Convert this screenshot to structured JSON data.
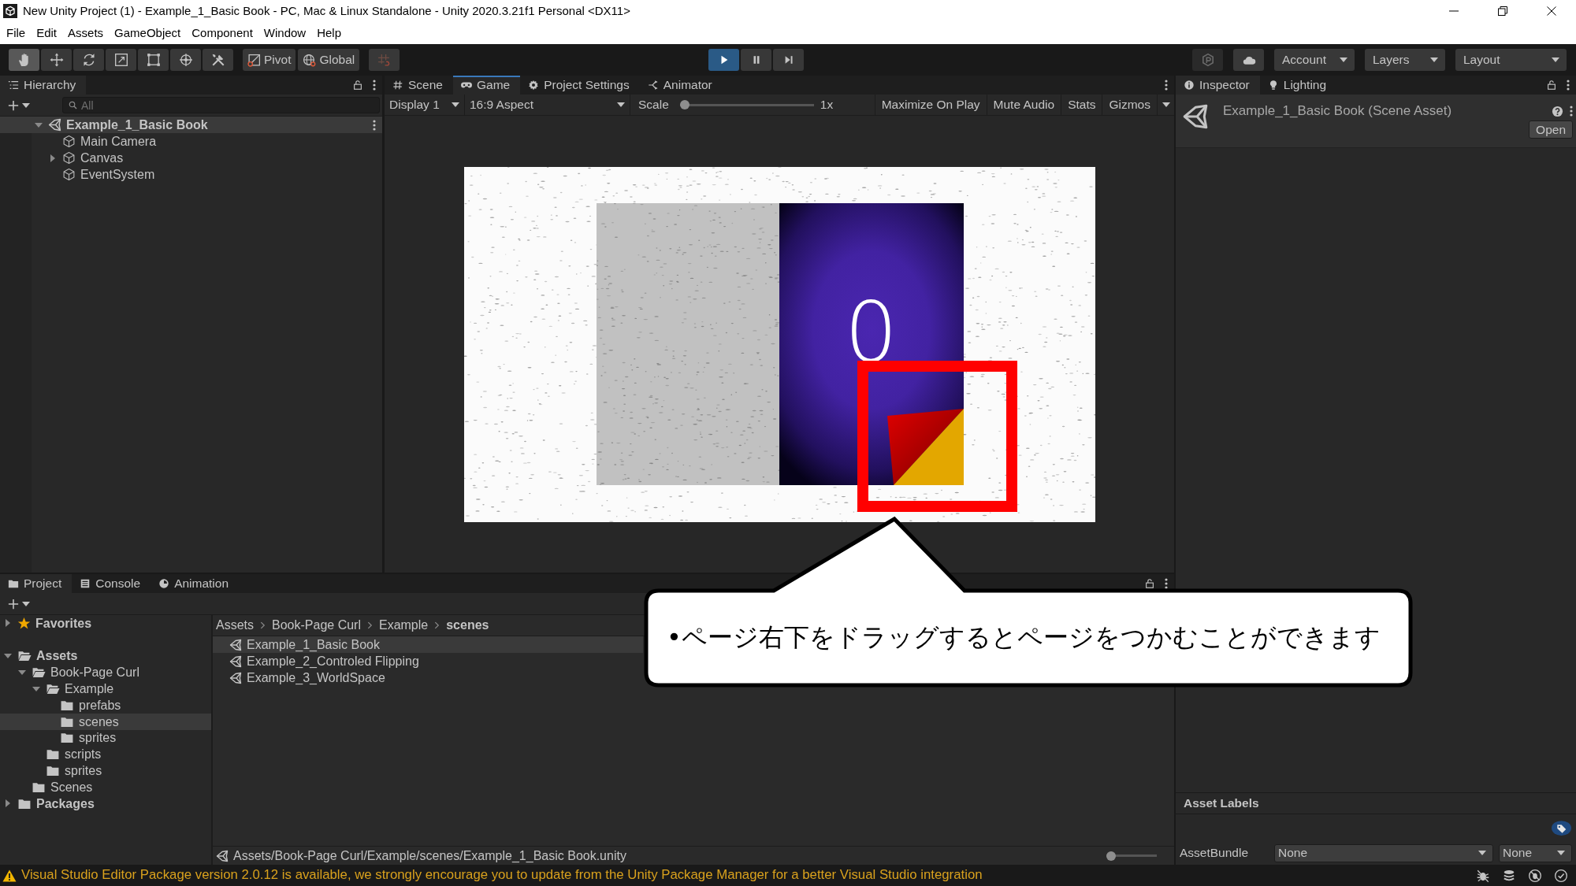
{
  "window": {
    "title": "New Unity Project (1) - Example_1_Basic Book - PC, Mac & Linux Standalone - Unity 2020.3.21f1 Personal <DX11>"
  },
  "menu": [
    "File",
    "Edit",
    "Assets",
    "GameObject",
    "Component",
    "Window",
    "Help"
  ],
  "toolbar": {
    "tools": [
      {
        "kind": "hand",
        "selected": true
      },
      {
        "kind": "move",
        "selected": false
      },
      {
        "kind": "rotate",
        "selected": false
      },
      {
        "kind": "scale",
        "selected": false
      },
      {
        "kind": "rect",
        "selected": false
      },
      {
        "kind": "transform",
        "selected": false
      },
      {
        "kind": "custom",
        "selected": false
      }
    ],
    "handle_position": "Pivot",
    "handle_rotation": "Global",
    "playing": true,
    "paused": false,
    "dropdowns": [
      "Account",
      "Layers",
      "Layout"
    ]
  },
  "hierarchy": {
    "focused": false,
    "tabs": [
      {
        "kind": "list",
        "label": "Hierarchy",
        "selected": true
      }
    ],
    "search": {
      "placeholder": "All"
    },
    "scene": {
      "name": "Example_1_Basic Book",
      "expanded": true
    },
    "objects": [
      {
        "name": "Main Camera",
        "expandable": false
      },
      {
        "name": "Canvas",
        "expandable": true
      },
      {
        "name": "EventSystem",
        "expandable": false
      }
    ]
  },
  "game_panel": {
    "focused": true,
    "tabs": [
      {
        "kind": "scene",
        "label": "Scene",
        "selected": false
      },
      {
        "kind": "game",
        "label": "Game",
        "selected": true
      },
      {
        "kind": "settings",
        "label": "Project Settings",
        "selected": false
      },
      {
        "kind": "animator",
        "label": "Animator",
        "selected": false
      }
    ],
    "display": "Display 1",
    "aspect": "16:9 Aspect",
    "scale": {
      "label": "Scale",
      "level": 0,
      "reading": "1x"
    },
    "buttons": [
      "Maximize On Play",
      "Mute Audio",
      "Stats",
      "Gizmos"
    ],
    "game_view": {
      "page_number": "0"
    }
  },
  "annotation": {
    "callout": "•ページ右下をドラッグするとページをつかむことができます"
  },
  "inspector": {
    "focused": false,
    "tabs": [
      {
        "kind": "info",
        "label": "Inspector",
        "selected": true
      },
      {
        "kind": "bulb",
        "label": "Lighting",
        "selected": false
      }
    ],
    "asset_title": "Example_1_Basic Book (Scene Asset)",
    "open_button": "Open",
    "labels_header": "Asset Labels",
    "asset_bundle": {
      "label": "AssetBundle",
      "value": "None",
      "variant": "None"
    }
  },
  "project": {
    "focused": false,
    "tabs": [
      {
        "kind": "folder",
        "label": "Project",
        "selected": true
      },
      {
        "kind": "console",
        "label": "Console",
        "selected": false
      },
      {
        "kind": "clock",
        "label": "Animation",
        "selected": false
      }
    ],
    "tree": [
      {
        "name": "Favorites",
        "kind": "favorites",
        "expandable": true,
        "expanded": false,
        "selected": false
      },
      {
        "name": "Assets",
        "kind": "folder",
        "expandable": true,
        "expanded": true,
        "selected": false,
        "children": [
          {
            "name": "Book-Page Curl",
            "kind": "folder",
            "expandable": true,
            "expanded": true,
            "selected": false,
            "children": [
              {
                "name": "Example",
                "kind": "folder",
                "expandable": true,
                "expanded": true,
                "selected": false,
                "children": [
                  {
                    "name": "prefabs",
                    "kind": "folder",
                    "expandable": false,
                    "expanded": false,
                    "selected": false
                  },
                  {
                    "name": "scenes",
                    "kind": "folder",
                    "expandable": false,
                    "expanded": false,
                    "selected": true
                  },
                  {
                    "name": "sprites",
                    "kind": "folder",
                    "expandable": false,
                    "expanded": false,
                    "selected": false
                  }
                ]
              },
              {
                "name": "scripts",
                "kind": "folder",
                "expandable": false,
                "expanded": false,
                "selected": false
              },
              {
                "name": "sprites",
                "kind": "folder",
                "expandable": false,
                "expanded": false,
                "selected": false
              }
            ]
          },
          {
            "name": "Scenes",
            "kind": "folder",
            "expandable": false,
            "expanded": false,
            "selected": false
          }
        ]
      },
      {
        "name": "Packages",
        "kind": "folder",
        "expandable": true,
        "expanded": false,
        "selected": false
      }
    ],
    "breadcrumb": [
      "Assets",
      "Book-Page Curl",
      "Example",
      "scenes"
    ],
    "files": [
      {
        "name": "Example_1_Basic Book",
        "selected": true
      },
      {
        "name": "Example_2_Controled Flipping",
        "selected": false
      },
      {
        "name": "Example_3_WorldSpace",
        "selected": false
      }
    ],
    "path": "Assets/Book-Page Curl/Example/scenes/Example_1_Basic Book.unity",
    "icon_size": {
      "level": 0
    }
  },
  "status_bar": {
    "kind": "warning",
    "message": "Visual Studio Editor Package version 2.0.12 is available, we strongly encourage you to update from the Unity Package Manager for a better Visual Studio integration"
  }
}
